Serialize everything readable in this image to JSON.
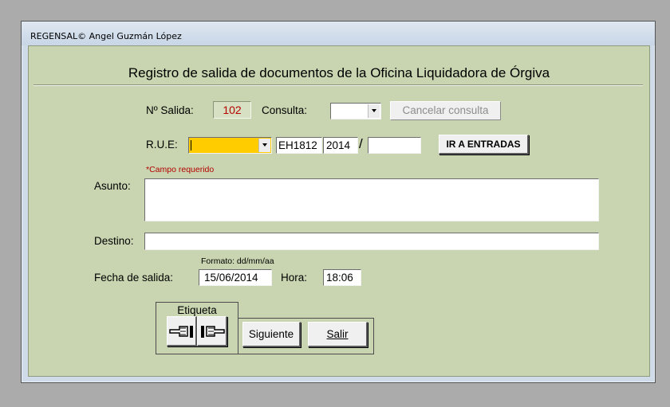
{
  "window": {
    "title": "REGENSAL© Angel Guzmán López"
  },
  "form": {
    "heading": "Registro de salida de documentos de la Oficina Liquidadora de Órgiva",
    "salida_label": "Nº Salida:",
    "salida_value": "102",
    "consulta_label": "Consulta:",
    "consulta_value": "",
    "cancelar_label": "Cancelar consulta",
    "rue_label": "R.U.E:",
    "rue_select_value": "",
    "rue_code": "EH1812",
    "rue_year": "2014",
    "rue_slash": "/",
    "rue_number": "",
    "ir_entradas_label": "IR A ENTRADAS",
    "required_note": "*Campo requerido",
    "asunto_label": "Asunto:",
    "asunto_value": "",
    "destino_label": "Destino:",
    "destino_value": "",
    "format_hint": "Formato: dd/mm/aa",
    "fecha_label": "Fecha de salida:",
    "fecha_value": "15/06/2014",
    "hora_label": "Hora:",
    "hora_value": "18:06",
    "etiqueta_label": "Etiqueta",
    "siguiente_label": "Siguiente",
    "salir_label": "Salir"
  },
  "colors": {
    "form_bg": "#c8d5b0",
    "salida_value_color": "#b40000",
    "rue_select_bg": "#ffcc00",
    "required_color": "#b40000"
  },
  "icons": {
    "prev": "hand-pointing-left-icon",
    "next": "hand-pointing-right-icon"
  }
}
